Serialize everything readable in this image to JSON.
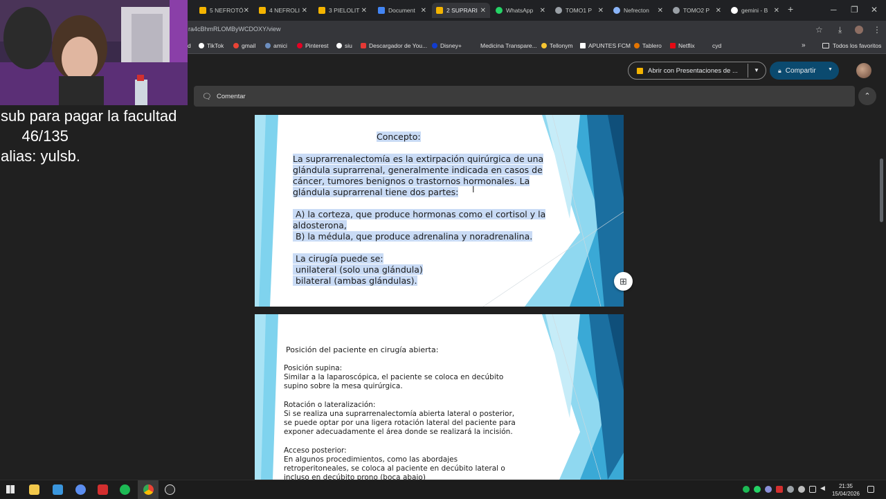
{
  "browser": {
    "tabs": [
      {
        "label": "5 NEFROTÓ",
        "icon": "slides-icon",
        "color": "#f4b400"
      },
      {
        "label": "4 NEFROLI",
        "icon": "slides-icon",
        "color": "#f4b400"
      },
      {
        "label": "3 PIELOLIT",
        "icon": "slides-icon",
        "color": "#f4b400"
      },
      {
        "label": "Document",
        "icon": "docs-icon",
        "color": "#4285f4"
      },
      {
        "label": "2 SUPRARI",
        "icon": "slides-icon",
        "color": "#f4b400",
        "active": true
      },
      {
        "label": "WhatsApp",
        "icon": "whatsapp-icon",
        "color": "#25d366"
      },
      {
        "label": "TOMO1 P",
        "icon": "globe-icon",
        "color": "#9aa0a6"
      },
      {
        "label": "Nefrecton",
        "icon": "gemini-icon",
        "color": "#8ab4f8"
      },
      {
        "label": "TOMO2 P",
        "icon": "globe-icon",
        "color": "#9aa0a6"
      },
      {
        "label": "gemini - B",
        "icon": "google-icon",
        "color": "#ffffff"
      }
    ],
    "url": "ra4cBhmRLOMByWCDOXY/view",
    "bookmarks": [
      {
        "label": "d",
        "color": "#9aa0a6"
      },
      {
        "label": "TikTok",
        "color": "#ffffff"
      },
      {
        "label": "gmail",
        "color": "#ea4335"
      },
      {
        "label": "amici",
        "color": "#6c8ebf"
      },
      {
        "label": "Pinterest",
        "color": "#e60023"
      },
      {
        "label": "siu",
        "color": "#ffffff"
      },
      {
        "label": "Descargador de You...",
        "color": "#e53935"
      },
      {
        "label": "Disney+",
        "color": "#113ccf"
      },
      {
        "label": "Medicina Transpare...",
        "color": "#35363a"
      },
      {
        "label": "Tellonym",
        "color": "#f7c531"
      },
      {
        "label": "APUNTES FCM",
        "color": "#ffffff"
      },
      {
        "label": "Tablero",
        "color": "#e37400"
      },
      {
        "label": "Netflix",
        "color": "#e50914"
      },
      {
        "label": "cyd",
        "color": "#35363a"
      }
    ],
    "all_favorites": "Todos los favoritos"
  },
  "viewer": {
    "open_with": "Abrir con Presentaciones de ...",
    "share": "Compartir",
    "comment": "Comentar"
  },
  "slide1": {
    "heading": "Concepto:",
    "paragraph": [
      "La suprarrenalectomía es la extirpación quirúrgica de una",
      "glándula suprarrenal, generalmente indicada en casos de",
      "cáncer, tumores benignos o trastornos hormonales. La",
      "glándula suprarrenal tiene dos partes:"
    ],
    "parts": [
      " A) la corteza, que produce hormonas como el cortisol y la",
      "aldosterona,",
      " B) la médula, que produce adrenalina y noradrenalina."
    ],
    "surgery": [
      " La cirugía puede se:",
      " unilateral (solo una glándula)",
      " bilateral (ambas glándulas)."
    ]
  },
  "slide2": {
    "heading": "Posición del paciente en cirugía abierta:",
    "lines": [
      "Posición supina:",
      "Similar a la laparoscópica, el paciente se coloca en decúbito",
      "supino sobre la mesa quirúrgica.",
      "",
      "Rotación o lateralización:",
      "Si se realiza una suprarrenalectomía abierta lateral o posterior,",
      "se puede optar por una ligera rotación lateral del paciente para",
      "exponer adecuadamente el área donde se realizará la incisión.",
      "",
      "Acceso posterior:",
      "En algunos procedimientos, como las abordajes",
      "retroperitoneales, se coloca al paciente en decúbito lateral o",
      "incluso en decúbito prono (boca abajo)"
    ]
  },
  "stream_overlay": {
    "line1": "sub para pagar la facultad",
    "line2": "     46/135",
    "line3": "alias: yulsb."
  },
  "taskbar": {
    "time": "21:35",
    "date": "15/04/2026"
  }
}
